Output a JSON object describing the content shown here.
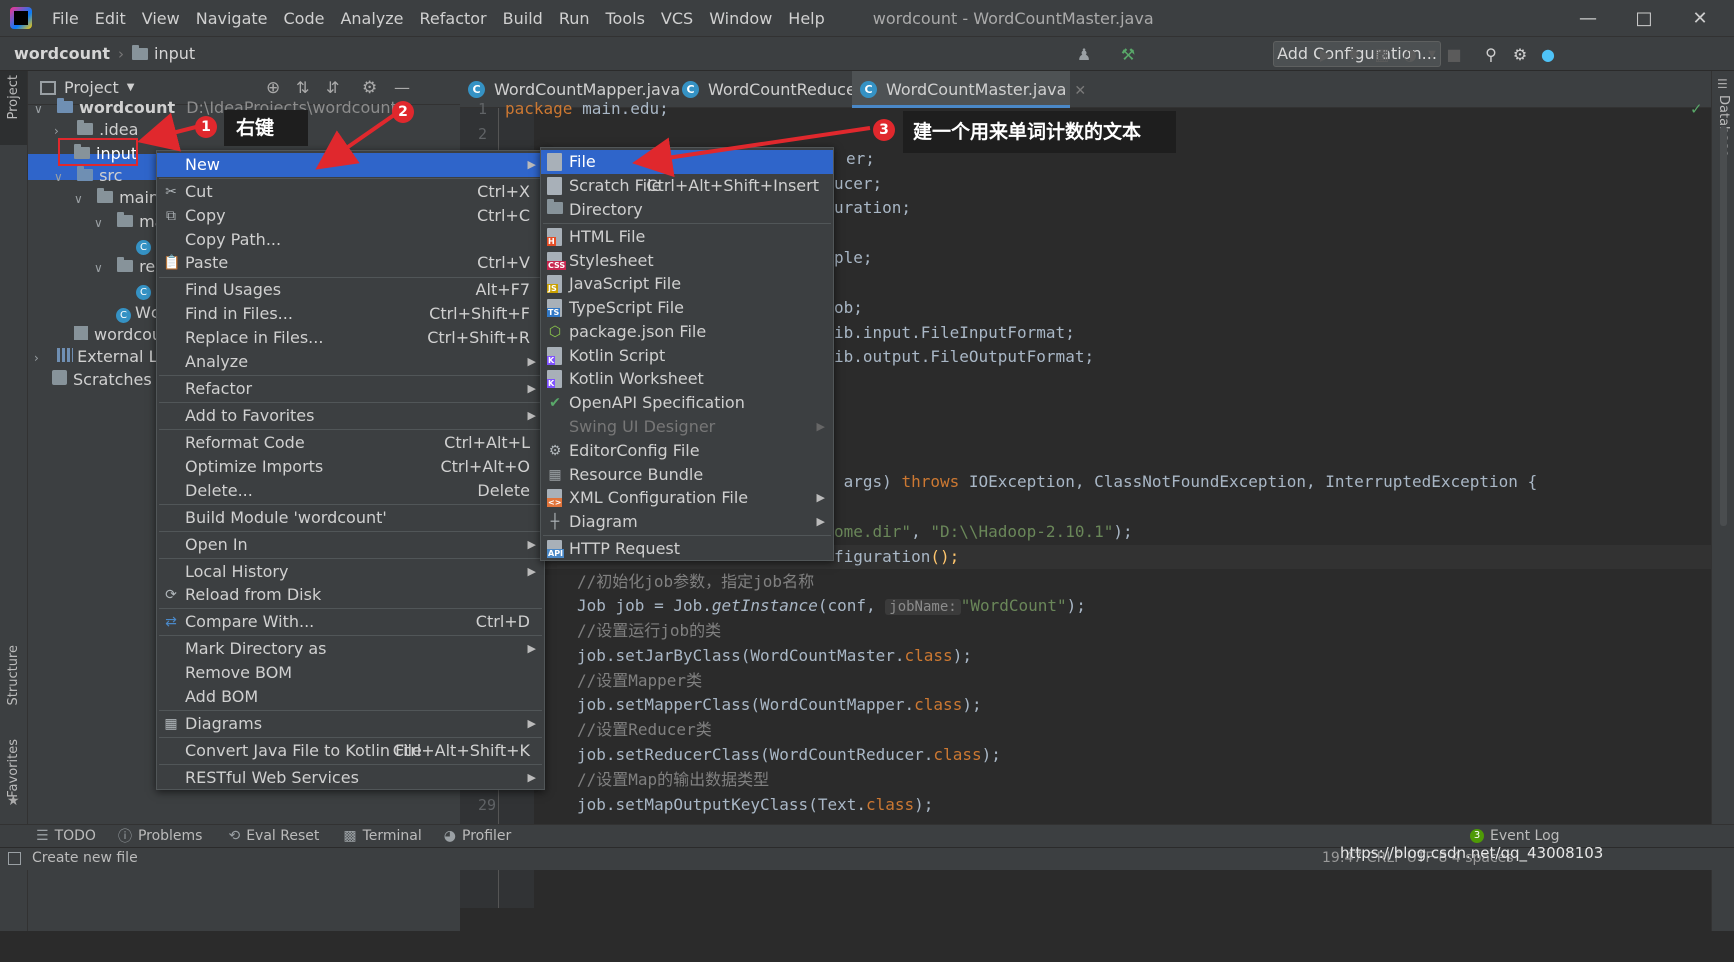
{
  "menubar": {
    "items": [
      "File",
      "Edit",
      "View",
      "Navigate",
      "Code",
      "Analyze",
      "Refactor",
      "Build",
      "Run",
      "Tools",
      "VCS",
      "Window",
      "Help"
    ],
    "title": "wordcount - WordCountMaster.java"
  },
  "navbar": {
    "project": "wordcount",
    "folder": "input",
    "add_configuration": "Add Configuration..."
  },
  "left_strip": {
    "project": "Project",
    "structure": "Structure",
    "favorites": "Favorites"
  },
  "right_strip": {
    "database": "Database"
  },
  "project_panel": {
    "title": "Project",
    "tree": [
      {
        "label": "wordcount",
        "path": "D:\\IdeaProjects\\wordcount"
      },
      {
        "label": ".idea"
      },
      {
        "label": "input"
      },
      {
        "label": "src"
      },
      {
        "label": "main.e"
      },
      {
        "label": "ma"
      },
      {
        "label": "rec"
      },
      {
        "label": "Wc"
      },
      {
        "label": "wordcou"
      },
      {
        "label": "External Libr"
      },
      {
        "label": "Scratches an"
      }
    ]
  },
  "tabs": [
    {
      "label": "WordCountMapper.java"
    },
    {
      "label": "WordCountReducer.java"
    },
    {
      "label": "WordCountMaster.java"
    }
  ],
  "gutter": {
    "lines": [
      "1",
      "2",
      "29"
    ]
  },
  "code": {
    "l1_kw": "package",
    "l1_rest": " main.edu;",
    "frag1": "er;",
    "frag2": "ucer;",
    "frag3": "uration;",
    "frag4": "ple;",
    "frag5": "ob;",
    "frag6": "ib.input.FileInputFormat;",
    "frag7": "ib.output.FileOutputFormat;",
    "args_a": " args) ",
    "args_kw": "throws",
    "args_b": " IOException, ClassNotFoundException, InterruptedException {",
    "home_str": "ome.dir\"",
    "home_mid": ", ",
    "home_str2": "\"D:\\\\Hadoop-2.10.1\"",
    "home_end": ");",
    "conf_a": "figuration",
    "conf_b": "();",
    "c1": "//初始化job参数，指定job名称",
    "job1_a": "Job job = Job.",
    "job1_fn": "getInstance",
    "job1_b": "(conf, ",
    "job1_hint": "jobName:",
    "job1_str": "\"WordCount\"",
    "job1_c": ");",
    "c2": "//设置运行job的类",
    "s1_a": "job.setJarByClass(WordCountMaster.",
    "s1_kw": "class",
    "s1_b": ");",
    "c3": "//设置Mapper类",
    "s2_a": "job.setMapperClass(WordCountMapper.",
    "s2_kw": "class",
    "s2_b": ");",
    "c4": "//设置Reducer类",
    "s3_a": "job.setReducerClass(WordCountReducer.",
    "s3_kw": "class",
    "s3_b": ");",
    "c5": "//设置Map的输出数据类型",
    "s4_a": "job.setMapOutputKeyClass(Text.",
    "s4_kw": "class",
    "s4_b": ");"
  },
  "context_menu": {
    "items": [
      {
        "label": "New",
        "submenu": true
      },
      {
        "label": "Cut",
        "shortcut": "Ctrl+X"
      },
      {
        "label": "Copy",
        "shortcut": "Ctrl+C"
      },
      {
        "label": "Copy Path..."
      },
      {
        "label": "Paste",
        "shortcut": "Ctrl+V"
      },
      {
        "label": "Find Usages",
        "shortcut": "Alt+F7"
      },
      {
        "label": "Find in Files...",
        "shortcut": "Ctrl+Shift+F"
      },
      {
        "label": "Replace in Files...",
        "shortcut": "Ctrl+Shift+R"
      },
      {
        "label": "Analyze",
        "submenu": true
      },
      {
        "label": "Refactor",
        "submenu": true
      },
      {
        "label": "Add to Favorites",
        "submenu": true
      },
      {
        "label": "Reformat Code",
        "shortcut": "Ctrl+Alt+L"
      },
      {
        "label": "Optimize Imports",
        "shortcut": "Ctrl+Alt+O"
      },
      {
        "label": "Delete...",
        "shortcut": "Delete"
      },
      {
        "label": "Build Module 'wordcount'"
      },
      {
        "label": "Open In",
        "submenu": true
      },
      {
        "label": "Local History",
        "submenu": true
      },
      {
        "label": "Reload from Disk"
      },
      {
        "label": "Compare With...",
        "shortcut": "Ctrl+D"
      },
      {
        "label": "Mark Directory as",
        "submenu": true
      },
      {
        "label": "Remove BOM"
      },
      {
        "label": "Add BOM"
      },
      {
        "label": "Diagrams",
        "submenu": true
      },
      {
        "label": "Convert Java File to Kotlin File",
        "shortcut": "Ctrl+Alt+Shift+K"
      },
      {
        "label": "RESTful Web Services",
        "submenu": true
      }
    ]
  },
  "new_submenu": {
    "items": [
      {
        "label": "File"
      },
      {
        "label": "Scratch File",
        "shortcut": "Ctrl+Alt+Shift+Insert"
      },
      {
        "label": "Directory"
      },
      {
        "label": "HTML File"
      },
      {
        "label": "Stylesheet"
      },
      {
        "label": "JavaScript File"
      },
      {
        "label": "TypeScript File"
      },
      {
        "label": "package.json File"
      },
      {
        "label": "Kotlin Script"
      },
      {
        "label": "Kotlin Worksheet"
      },
      {
        "label": "OpenAPI Specification"
      },
      {
        "label": "Swing UI Designer"
      },
      {
        "label": "EditorConfig File"
      },
      {
        "label": "Resource Bundle"
      },
      {
        "label": "XML Configuration File"
      },
      {
        "label": "Diagram"
      },
      {
        "label": "HTTP Request"
      }
    ]
  },
  "annotations": {
    "n1": "1",
    "t1": "右键",
    "n2": "2",
    "n3": "3",
    "t3": "建一个用来单词计数的文本"
  },
  "bottom_tools": [
    "TODO",
    "Problems",
    "Eval Reset",
    "Terminal",
    "Profiler"
  ],
  "event_log": {
    "count": "3",
    "label": "Event Log"
  },
  "status": {
    "message": "Create new file",
    "right": "19:47  CRLF  UTF-8  4 spaces",
    "watermark": "https://blog.csdn.net/qq_43008103"
  },
  "colors": {
    "accent": "#2f65ca",
    "annotation": "#e0282d",
    "keyword": "#cc7832",
    "string": "#6a8759"
  }
}
